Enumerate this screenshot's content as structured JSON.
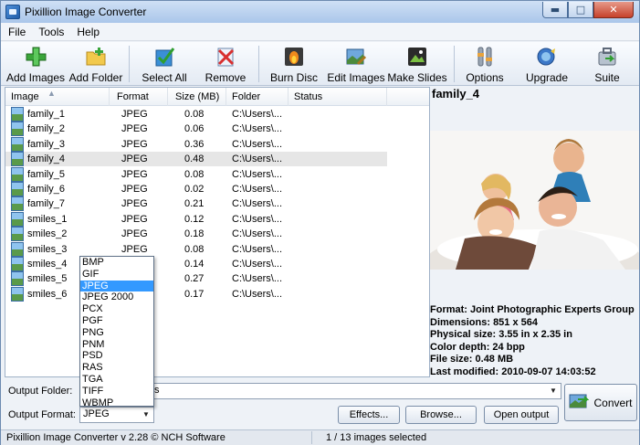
{
  "window": {
    "title": "Pixillion Image Converter"
  },
  "menu": {
    "file": "File",
    "tools": "Tools",
    "help": "Help"
  },
  "toolbar": {
    "add_images": "Add Images",
    "add_folder": "Add Folder",
    "select_all": "Select All",
    "remove": "Remove",
    "burn_disc": "Burn Disc",
    "edit_images": "Edit Images",
    "make_slides": "Make Slides",
    "options": "Options",
    "upgrade": "Upgrade",
    "suite": "Suite"
  },
  "list": {
    "headers": {
      "image": "Image",
      "format": "Format",
      "size": "Size (MB)",
      "folder": "Folder",
      "status": "Status"
    },
    "rows": [
      {
        "name": "family_1",
        "format": "JPEG",
        "size": "0.08",
        "folder": "C:\\Users\\..."
      },
      {
        "name": "family_2",
        "format": "JPEG",
        "size": "0.06",
        "folder": "C:\\Users\\..."
      },
      {
        "name": "family_3",
        "format": "JPEG",
        "size": "0.36",
        "folder": "C:\\Users\\..."
      },
      {
        "name": "family_4",
        "format": "JPEG",
        "size": "0.48",
        "folder": "C:\\Users\\..."
      },
      {
        "name": "family_5",
        "format": "JPEG",
        "size": "0.08",
        "folder": "C:\\Users\\..."
      },
      {
        "name": "family_6",
        "format": "JPEG",
        "size": "0.02",
        "folder": "C:\\Users\\..."
      },
      {
        "name": "family_7",
        "format": "JPEG",
        "size": "0.21",
        "folder": "C:\\Users\\..."
      },
      {
        "name": "smiles_1",
        "format": "JPEG",
        "size": "0.12",
        "folder": "C:\\Users\\..."
      },
      {
        "name": "smiles_2",
        "format": "JPEG",
        "size": "0.18",
        "folder": "C:\\Users\\..."
      },
      {
        "name": "smiles_3",
        "format": "JPEG",
        "size": "0.08",
        "folder": "C:\\Users\\..."
      },
      {
        "name": "smiles_4",
        "format": "",
        "size": "0.14",
        "folder": "C:\\Users\\..."
      },
      {
        "name": "smiles_5",
        "format": "",
        "size": "0.27",
        "folder": "C:\\Users\\..."
      },
      {
        "name": "smiles_6",
        "format": "",
        "size": "0.17",
        "folder": "C:\\Users\\..."
      }
    ]
  },
  "preview": {
    "name": "family_4",
    "format": "Format: Joint Photographic Experts Group",
    "dimensions": "Dimensions: 851 x 564",
    "physical": "Physical size: 3.55 in x 2.35 in",
    "depth": "Color depth: 24 bpp",
    "filesize": "File size: 0.48 MB",
    "modified": "Last modified: 2010-09-07 14:03:52"
  },
  "output": {
    "folder_label": "Output Folder:",
    "folder_value": "s",
    "format_label": "Output Format:",
    "format_value": "JPEG",
    "effects": "Effects...",
    "browse": "Browse...",
    "open_output": "Open output",
    "convert": "Convert"
  },
  "format_options": [
    "BMP",
    "GIF",
    "JPEG",
    "JPEG 2000",
    "PCX",
    "PGF",
    "PNG",
    "PNM",
    "PSD",
    "RAS",
    "TGA",
    "TIFF",
    "WBMP"
  ],
  "format_selected": "JPEG",
  "status": {
    "version": "Pixillion Image Converter v 2.28 © NCH Software",
    "selection": "1 / 13 images selected"
  }
}
